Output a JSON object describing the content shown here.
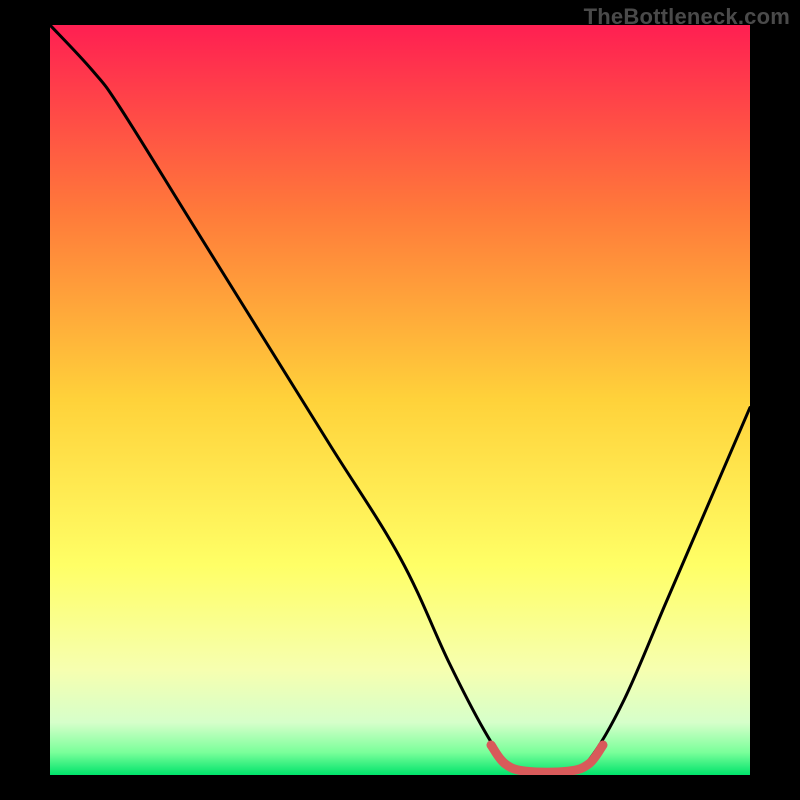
{
  "watermark": "TheBottleneck.com",
  "chart_data": {
    "type": "line",
    "title": "",
    "xlabel": "",
    "ylabel": "",
    "xlim": [
      0,
      100
    ],
    "ylim": [
      0,
      100
    ],
    "grid": false,
    "legend": false,
    "gradient_stops": [
      {
        "offset": 0.0,
        "color": "#ff1f52"
      },
      {
        "offset": 0.25,
        "color": "#ff7a3a"
      },
      {
        "offset": 0.5,
        "color": "#ffd23a"
      },
      {
        "offset": 0.72,
        "color": "#ffff66"
      },
      {
        "offset": 0.86,
        "color": "#f6ffb0"
      },
      {
        "offset": 0.93,
        "color": "#d6ffca"
      },
      {
        "offset": 0.97,
        "color": "#7aff9a"
      },
      {
        "offset": 1.0,
        "color": "#00e36b"
      }
    ],
    "series": [
      {
        "name": "curve",
        "color": "#000000",
        "points": [
          {
            "x": 0,
            "y": 100
          },
          {
            "x": 6,
            "y": 94
          },
          {
            "x": 10,
            "y": 89
          },
          {
            "x": 20,
            "y": 74
          },
          {
            "x": 30,
            "y": 59
          },
          {
            "x": 40,
            "y": 44
          },
          {
            "x": 50,
            "y": 29
          },
          {
            "x": 57,
            "y": 15
          },
          {
            "x": 62,
            "y": 6
          },
          {
            "x": 65,
            "y": 2
          },
          {
            "x": 68,
            "y": 0.5
          },
          {
            "x": 74,
            "y": 0.5
          },
          {
            "x": 77,
            "y": 2
          },
          {
            "x": 82,
            "y": 10
          },
          {
            "x": 88,
            "y": 23
          },
          {
            "x": 94,
            "y": 36
          },
          {
            "x": 100,
            "y": 49
          }
        ]
      },
      {
        "name": "highlight-segment",
        "color": "#d85a5a",
        "thick": true,
        "points": [
          {
            "x": 63,
            "y": 4
          },
          {
            "x": 65,
            "y": 1.5
          },
          {
            "x": 68,
            "y": 0.5
          },
          {
            "x": 74,
            "y": 0.5
          },
          {
            "x": 77,
            "y": 1.5
          },
          {
            "x": 79,
            "y": 4
          }
        ]
      }
    ]
  }
}
